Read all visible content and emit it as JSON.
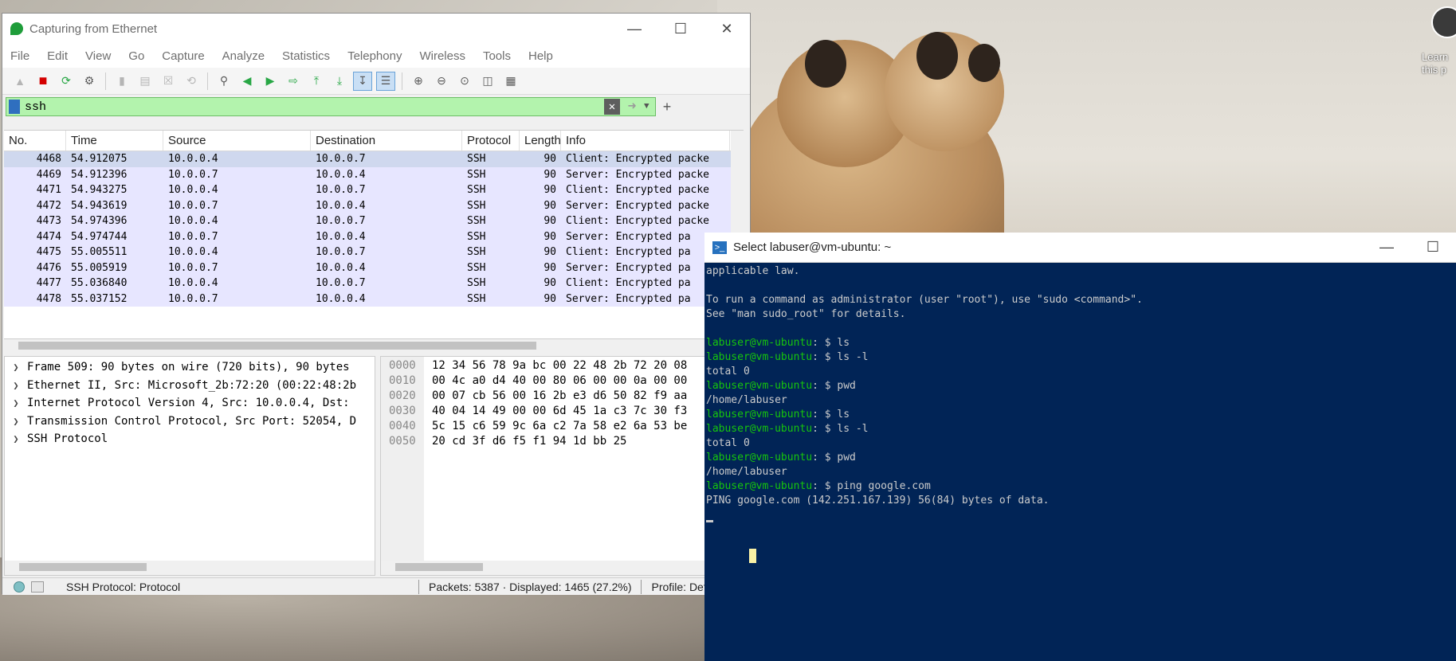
{
  "notification": {
    "text": "Learn\nthis p"
  },
  "wireshark": {
    "title": "Capturing from Ethernet",
    "menu": [
      "File",
      "Edit",
      "View",
      "Go",
      "Capture",
      "Analyze",
      "Statistics",
      "Telephony",
      "Wireless",
      "Tools",
      "Help"
    ],
    "filter": {
      "value": "ssh"
    },
    "columns": [
      "No.",
      "Time",
      "Source",
      "Destination",
      "Protocol",
      "Length",
      "Info"
    ],
    "packets": [
      {
        "no": "4468",
        "time": "54.912075",
        "src": "10.0.0.4",
        "dst": "10.0.0.7",
        "proto": "SSH",
        "len": "90",
        "info": "Client: Encrypted packe"
      },
      {
        "no": "4469",
        "time": "54.912396",
        "src": "10.0.0.7",
        "dst": "10.0.0.4",
        "proto": "SSH",
        "len": "90",
        "info": "Server: Encrypted packe"
      },
      {
        "no": "4471",
        "time": "54.943275",
        "src": "10.0.0.4",
        "dst": "10.0.0.7",
        "proto": "SSH",
        "len": "90",
        "info": "Client: Encrypted packe"
      },
      {
        "no": "4472",
        "time": "54.943619",
        "src": "10.0.0.7",
        "dst": "10.0.0.4",
        "proto": "SSH",
        "len": "90",
        "info": "Server: Encrypted packe"
      },
      {
        "no": "4473",
        "time": "54.974396",
        "src": "10.0.0.4",
        "dst": "10.0.0.7",
        "proto": "SSH",
        "len": "90",
        "info": "Client: Encrypted packe"
      },
      {
        "no": "4474",
        "time": "54.974744",
        "src": "10.0.0.7",
        "dst": "10.0.0.4",
        "proto": "SSH",
        "len": "90",
        "info": "Server: Encrypted pa"
      },
      {
        "no": "4475",
        "time": "55.005511",
        "src": "10.0.0.4",
        "dst": "10.0.0.7",
        "proto": "SSH",
        "len": "90",
        "info": "Client: Encrypted pa"
      },
      {
        "no": "4476",
        "time": "55.005919",
        "src": "10.0.0.7",
        "dst": "10.0.0.4",
        "proto": "SSH",
        "len": "90",
        "info": "Server: Encrypted pa"
      },
      {
        "no": "4477",
        "time": "55.036840",
        "src": "10.0.0.4",
        "dst": "10.0.0.7",
        "proto": "SSH",
        "len": "90",
        "info": "Client: Encrypted pa"
      },
      {
        "no": "4478",
        "time": "55.037152",
        "src": "10.0.0.7",
        "dst": "10.0.0.4",
        "proto": "SSH",
        "len": "90",
        "info": "Server: Encrypted pa"
      }
    ],
    "details": [
      "Frame 509: 90 bytes on wire (720 bits), 90 bytes",
      "Ethernet II, Src: Microsoft_2b:72:20 (00:22:48:2b",
      "Internet Protocol Version 4, Src: 10.0.0.4, Dst: ",
      "Transmission Control Protocol, Src Port: 52054, D",
      "SSH Protocol"
    ],
    "hex": [
      {
        "off": "0000",
        "bytes": "12 34 56 78 9a bc 00 22  48 2b 72 20 08"
      },
      {
        "off": "0010",
        "bytes": "00 4c a0 d4 40 00 80 06  00 00 0a 00 00"
      },
      {
        "off": "0020",
        "bytes": "00 07 cb 56 00 16 2b e3  d6 50 82 f9 aa"
      },
      {
        "off": "0030",
        "bytes": "40 04 14 49 00 00 6d 45  1a c3 7c 30 f3"
      },
      {
        "off": "0040",
        "bytes": "5c 15 c6 59 9c 6a c2 7a  58 e2 6a 53 be"
      },
      {
        "off": "0050",
        "bytes": "20 cd 3f d6 f5 f1 94 1d  bb 25"
      }
    ],
    "status": {
      "protocol": "SSH Protocol: Protocol",
      "packets": "Packets: 5387 · Displayed: 1465 (27.2%)",
      "profile": "Profile: Def"
    }
  },
  "terminal": {
    "title": "Select labuser@vm-ubuntu: ~",
    "lines": [
      {
        "text": "applicable law."
      },
      {
        "text": ""
      },
      {
        "text": "To run a command as administrator (user \"root\"), use \"sudo <command>\"."
      },
      {
        "text": "See \"man sudo_root\" for details."
      },
      {
        "text": ""
      },
      {
        "prompt": "labuser@vm-ubuntu",
        "text": ": $ ls"
      },
      {
        "prompt": "labuser@vm-ubuntu",
        "text": ": $ ls -l"
      },
      {
        "text": "total 0"
      },
      {
        "prompt": "labuser@vm-ubuntu",
        "text": ": $ pwd"
      },
      {
        "text": "/home/labuser"
      },
      {
        "prompt": "labuser@vm-ubuntu",
        "text": ": $ ls"
      },
      {
        "prompt": "labuser@vm-ubuntu",
        "text": ": $ ls -l"
      },
      {
        "text": "total 0"
      },
      {
        "prompt": "labuser@vm-ubuntu",
        "text": ": $ pwd"
      },
      {
        "text": "/home/labuser"
      },
      {
        "prompt": "labuser@vm-ubuntu",
        "text": ": $ ping google.com"
      },
      {
        "text": "PING google.com (142.251.167.139) 56(84) bytes of data."
      }
    ]
  }
}
